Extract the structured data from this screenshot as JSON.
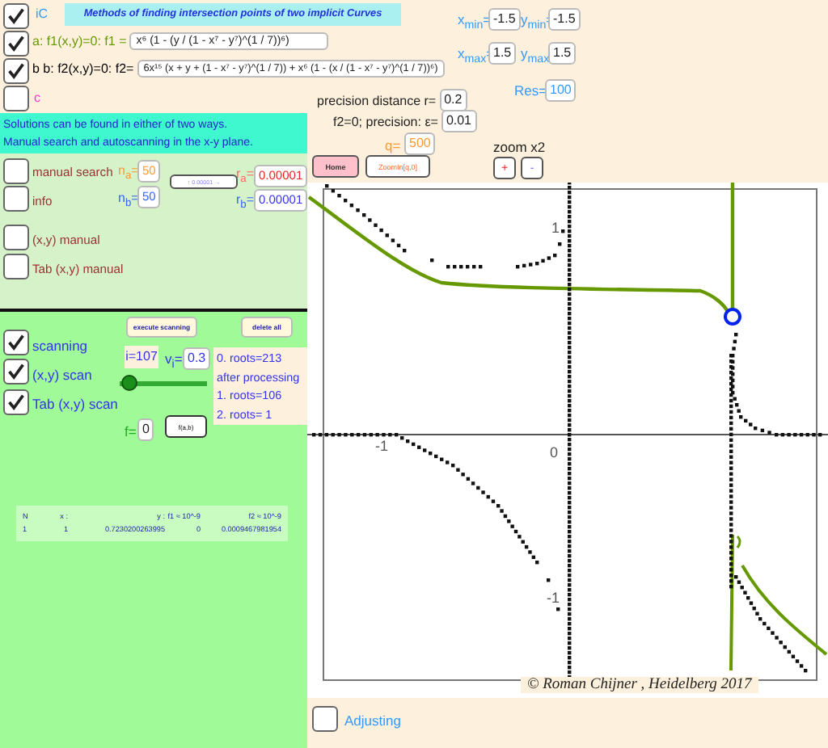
{
  "title": "Methods of finding intersection points of two implicit Curves",
  "curves": [
    {
      "label": "iC",
      "checked": true,
      "color": "#3399ff"
    },
    {
      "label": "a: f1(x,y)=0: f1 =",
      "value": "x⁶ (1 - (y / (1 - x⁷ - y⁷)^(1 / 7))⁶)",
      "checked": true,
      "color": "#669900"
    },
    {
      "label": "b b: f2(x,y)=0: f2=",
      "value": "6x¹⁵ (x + y + (1 - x⁷ - y⁷)^(1 / 7)) + x⁶ (1 - (x / (1 - x⁷ - y⁷)^(1 / 7))⁶)",
      "checked": true,
      "color": "#000000"
    },
    {
      "label": "c",
      "checked": false,
      "color": "#ff33cc"
    }
  ],
  "window": [
    {
      "label": "x$_{min}$=",
      "value": "-1.5"
    },
    {
      "label": "y$_{min}$=",
      "value": "-1.5"
    },
    {
      "label": "x$_{max}$=",
      "value": "1.5"
    },
    {
      "label": "y$_{max}$=",
      "value": "1.5"
    }
  ],
  "res": {
    "label": "Res=",
    "value": "100"
  },
  "precision": [
    {
      "label": "precision distance r=",
      "value": "0.2"
    },
    {
      "label": "f2=0; precision: ε=",
      "value": "0.01"
    }
  ],
  "q": {
    "label": "q=",
    "value": "500"
  },
  "zoom_label": "zoom x2",
  "view_buttons": [
    "Home",
    "ZoomIn[q,0]"
  ],
  "zoom_buttons": [
    "+",
    "-"
  ],
  "info": [
    "Solutions can be found  in  either of two ways.",
    "Manual search and autoscanning in the x-y plane."
  ],
  "manual": {
    "options": [
      {
        "label": "manual search",
        "checked": false
      },
      {
        "label": "info",
        "checked": false
      },
      {
        "label": "(x,y) manual",
        "checked": false
      },
      {
        "label": "Tab (x,y) manual",
        "checked": false
      }
    ],
    "fields": [
      {
        "label": "n$_{a}$=",
        "value": "50"
      },
      {
        "label": "n$_{b}$=",
        "value": "50"
      },
      {
        "label": "r$_{a}$=",
        "value": "0.00001"
      },
      {
        "label": "r$_{b}$=",
        "value": "0.00001"
      }
    ],
    "step_button": "↑ 0.00001 →"
  },
  "scan": {
    "buttons": [
      "execute scanning",
      "delete all"
    ],
    "options": [
      {
        "label": "scanning",
        "checked": true
      },
      {
        "label": "(x,y) scan",
        "checked": true
      },
      {
        "label": "Tab (x,y) scan",
        "checked": true
      }
    ],
    "counter": "i=107",
    "v": {
      "label": "v$_{i}$=",
      "value": "0.3"
    },
    "slider": {
      "level": 0.02
    },
    "results": [
      "0. roots=213",
      "after processing",
      "1. roots=106",
      "2. roots= 1"
    ],
    "f": {
      "label": "f=",
      "value": "0"
    },
    "f_button": "f(a,b)"
  },
  "table": {
    "columns": [
      "N",
      "x :",
      "y :",
      "f1 ≈ 10^-9",
      "f2 ≈ 10^-9"
    ],
    "rows": [
      [
        "1",
        "1",
        "0.7230200263995",
        "0",
        "0.0009467981954"
      ]
    ]
  },
  "graph": {
    "tick_labels": [
      "1",
      "-1",
      "0",
      "-1"
    ]
  },
  "copyright": "© Roman Chijner , Heidelberg 2017",
  "adjusting": {
    "label": "Adjusting",
    "checked": false
  }
}
